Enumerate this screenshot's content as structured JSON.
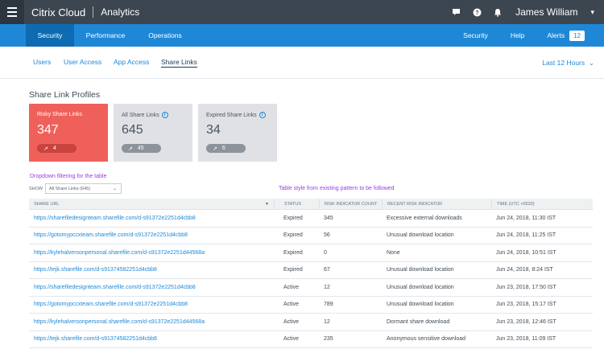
{
  "topbar": {
    "brand": "Citrix Cloud",
    "product": "Analytics",
    "user_name": "James William",
    "icons": [
      "chat-icon",
      "help-icon",
      "bell-icon"
    ]
  },
  "nav": {
    "left": [
      "Security",
      "Performance",
      "Operations"
    ],
    "right": [
      "Security",
      "Help",
      "Alerts"
    ],
    "alerts_count": "12"
  },
  "subtabs": {
    "items": [
      "Users",
      "User Access",
      "App Access",
      "Share Links"
    ],
    "active": "Share Links",
    "time_range": "Last 12 Hours"
  },
  "section_title": "Share Link Profiles",
  "cards": [
    {
      "label": "Risky Share Links",
      "value": "347",
      "delta": "4"
    },
    {
      "label": "All Share Links",
      "value": "645",
      "delta": "45"
    },
    {
      "label": "Expired Share Links",
      "value": "34",
      "delta": "6"
    }
  ],
  "annotations": {
    "dropdown_note": "Dropdown filtering for the table",
    "table_note": "Table style from existing pattern to be followed"
  },
  "filter": {
    "label": "SHOW",
    "value": "All Share Links (645)"
  },
  "table": {
    "headers": [
      "SHARE URL",
      "STATUS",
      "RISK INDICATOR COUNT",
      "RECENT RISK INDICATOR",
      "TIME (UTC +0530)"
    ],
    "rows": [
      [
        "https://sharefiledesignteam.sharefile.com/d-s91372e2251d4cbb8",
        "Expired",
        "345",
        "Excessive external downloads",
        "Jun 24, 2018, 11:30 IST"
      ],
      [
        "https://gotomypccxteam.sharefile.com/d-s91372e2251d4cbb8",
        "Expired",
        "56",
        "Unusual download location",
        "Jun 24, 2018, 11:25 IST"
      ],
      [
        "https://kylehalversonpersonal.sharefile.com/d-s91372e2251d44568a",
        "Expired",
        "0",
        "None",
        "Jun 24, 2018, 10:51 IST"
      ],
      [
        "https://tejk.sharefile.com/d-s91374582251d4cbb8",
        "Expired",
        "67",
        "Unusual download location",
        "Jun 24, 2018, 8:24 IST"
      ],
      [
        "https://sharefiledesignteam.sharefile.com/d-s91372e2251d4cbb8",
        "Active",
        "12",
        "Unusual download location",
        "Jun 23, 2018, 17:50 IST"
      ],
      [
        "https://gotomypccxteam.sharefile.com/d-s91372e2251d4cbb8",
        "Active",
        "789",
        "Unusual download location",
        "Jun 23, 2018, 15:17 IST"
      ],
      [
        "https://kylehalversonpersonal.sharefile.com/d-s91372e2251d44568a",
        "Active",
        "12",
        "Dormant share download",
        "Jun 23, 2018, 12:46 IST"
      ],
      [
        "https://tejk.sharefile.com/d-s91374582251d4cbb8",
        "Active",
        "235",
        "Anonymous sensitive download",
        "Jun 23, 2018, 11:09 IST"
      ]
    ]
  },
  "colors": {
    "topbar": "#3c4651",
    "nav": "#1e88d7",
    "nav_active": "#0e6bb3",
    "risky_card": "#f0605a",
    "link": "#1e88d7",
    "annotation": "#9b3ce0"
  }
}
